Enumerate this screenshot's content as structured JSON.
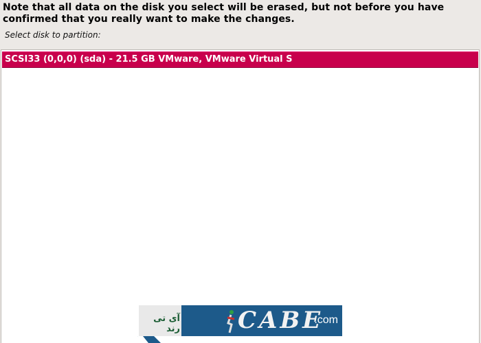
{
  "notice_text": "Note that all data on the disk you select will be erased, but not before you have confirmed that you really want to make the changes.",
  "select_label": "Select disk to partition:",
  "disks": [
    {
      "label": "SCSI33 (0,0,0) (sda) - 21.5 GB VMware, VMware Virtual S",
      "selected": true
    }
  ],
  "watermark": {
    "persian_text": "آی تی رند",
    "letters": "CABE",
    "domain_suffix": ".com"
  },
  "colors": {
    "background": "#ece9e6",
    "selection": "#c8004c",
    "list_background": "#ffffff",
    "watermark_blue": "#1d5a8a"
  },
  "icons": {
    "watermark_figure": "runner-figure-icon"
  }
}
